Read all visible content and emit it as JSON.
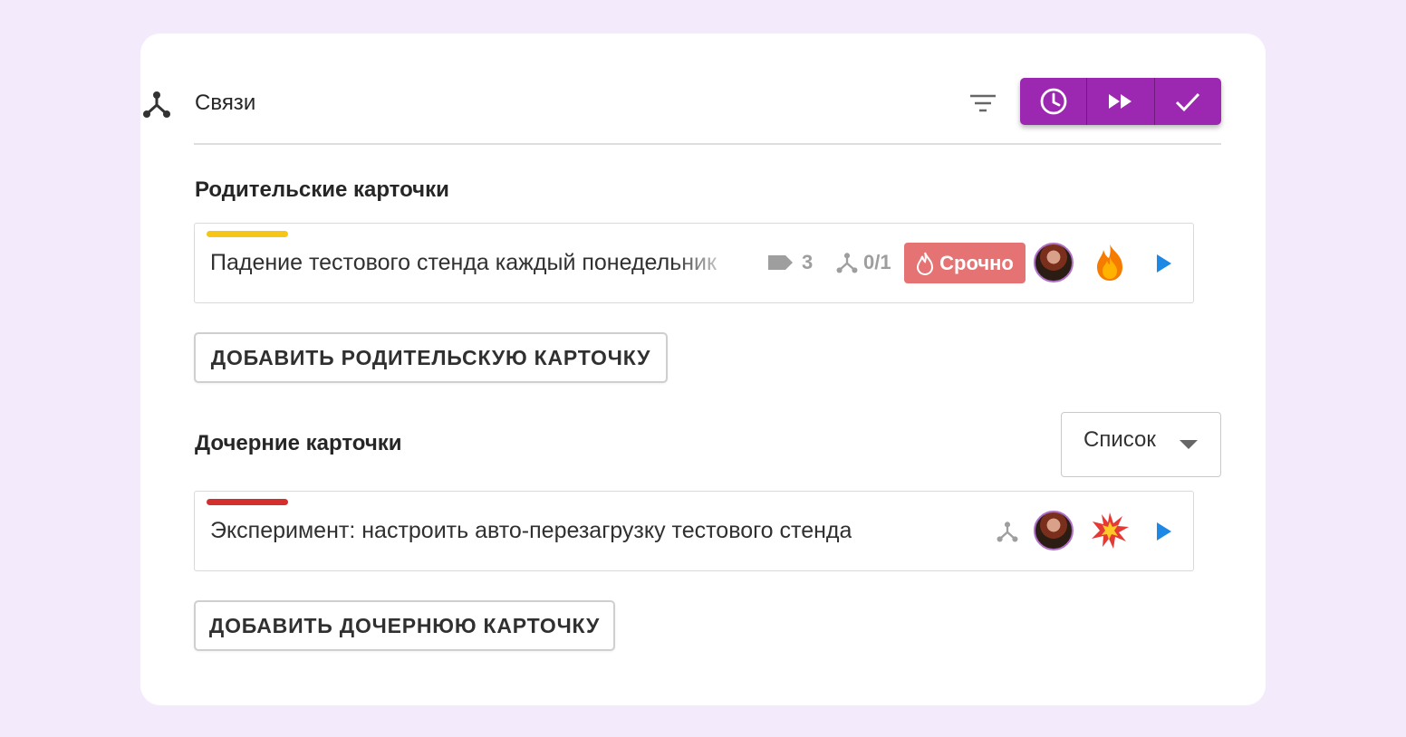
{
  "colors": {
    "background": "#f3ebfb",
    "accent": "#9c27b0",
    "urgent": "#e57373",
    "parent_bar": "#f5c518",
    "child_bar": "#d32f2f",
    "play": "#1e88e5"
  },
  "header": {
    "icon": "relations-icon",
    "title": "Связи",
    "actions": [
      "filter-icon",
      "clock-icon",
      "fast-forward-icon",
      "check-icon"
    ]
  },
  "parents": {
    "title": "Родительские карточки",
    "cards": [
      {
        "title": "Падение тестового стенда каждый понедельник",
        "tags_count": "3",
        "children_progress": "0/1",
        "badge": "Срочно",
        "emoji": "fire",
        "bar_color": "#f5c518"
      }
    ],
    "add_button": "ДОБАВИТЬ РОДИТЕЛЬСКУЮ КАРТОЧКУ"
  },
  "children": {
    "title": "Дочерние карточки",
    "view_select": "Список",
    "cards": [
      {
        "title": "Эксперимент: настроить авто-перезагрузку тестового стенда",
        "emoji": "collision",
        "bar_color": "#d32f2f"
      }
    ],
    "add_button": "ДОБАВИТЬ ДОЧЕРНЮЮ КАРТОЧКУ"
  }
}
